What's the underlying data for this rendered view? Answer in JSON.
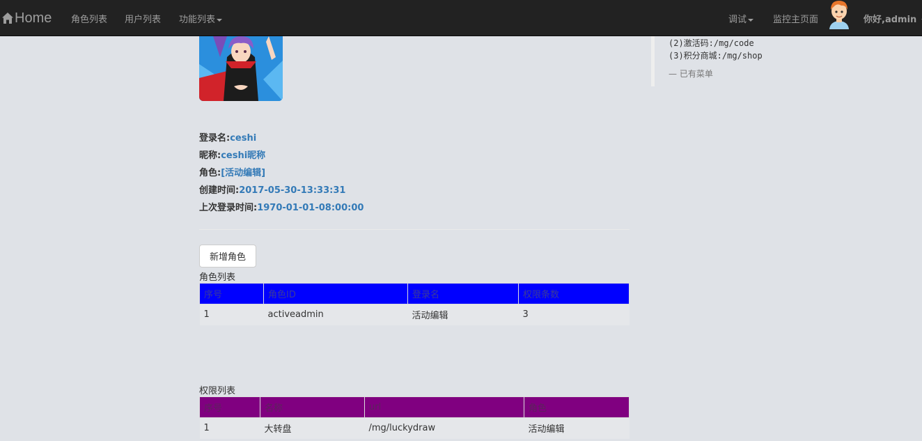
{
  "nav": {
    "brand": "Home",
    "links": [
      "角色列表",
      "用户列表",
      "功能列表"
    ],
    "debug": "调试",
    "monitor": "监控主页面",
    "greeting": "你好,admin"
  },
  "sidebar": {
    "lines": [
      "(2)激活码:/mg/code",
      "(3)积分商城:/mg/shop"
    ],
    "footer": "— 已有菜单"
  },
  "profile": {
    "login_label": "登录名:",
    "login_value": "ceshi",
    "nick_label": "昵称:",
    "nick_value": "ceshi昵称",
    "role_label": "角色:",
    "role_value": "[活动编辑]",
    "created_label": "创建时间:",
    "created_value": "2017-05-30-13:33:31",
    "last_login_label": "上次登录时间:",
    "last_login_value": "1970-01-01-08:00:00"
  },
  "add_role_button": "新增角色",
  "role_table": {
    "caption": "角色列表",
    "headers": [
      "序号",
      "角色ID",
      "登录名",
      "权限条数"
    ],
    "rows": [
      [
        "1",
        "activeadmin",
        "活动编辑",
        "3"
      ]
    ]
  },
  "perm_table": {
    "caption": "权限列表",
    "headers": [
      "序号",
      "名称",
      "url",
      "角色"
    ],
    "rows": [
      [
        "1",
        "大转盘",
        "/mg/luckydraw",
        "活动编辑"
      ]
    ]
  },
  "colors": {
    "role_header": "#0000ff",
    "perm_header": "#800080",
    "navbar": "#222222"
  }
}
